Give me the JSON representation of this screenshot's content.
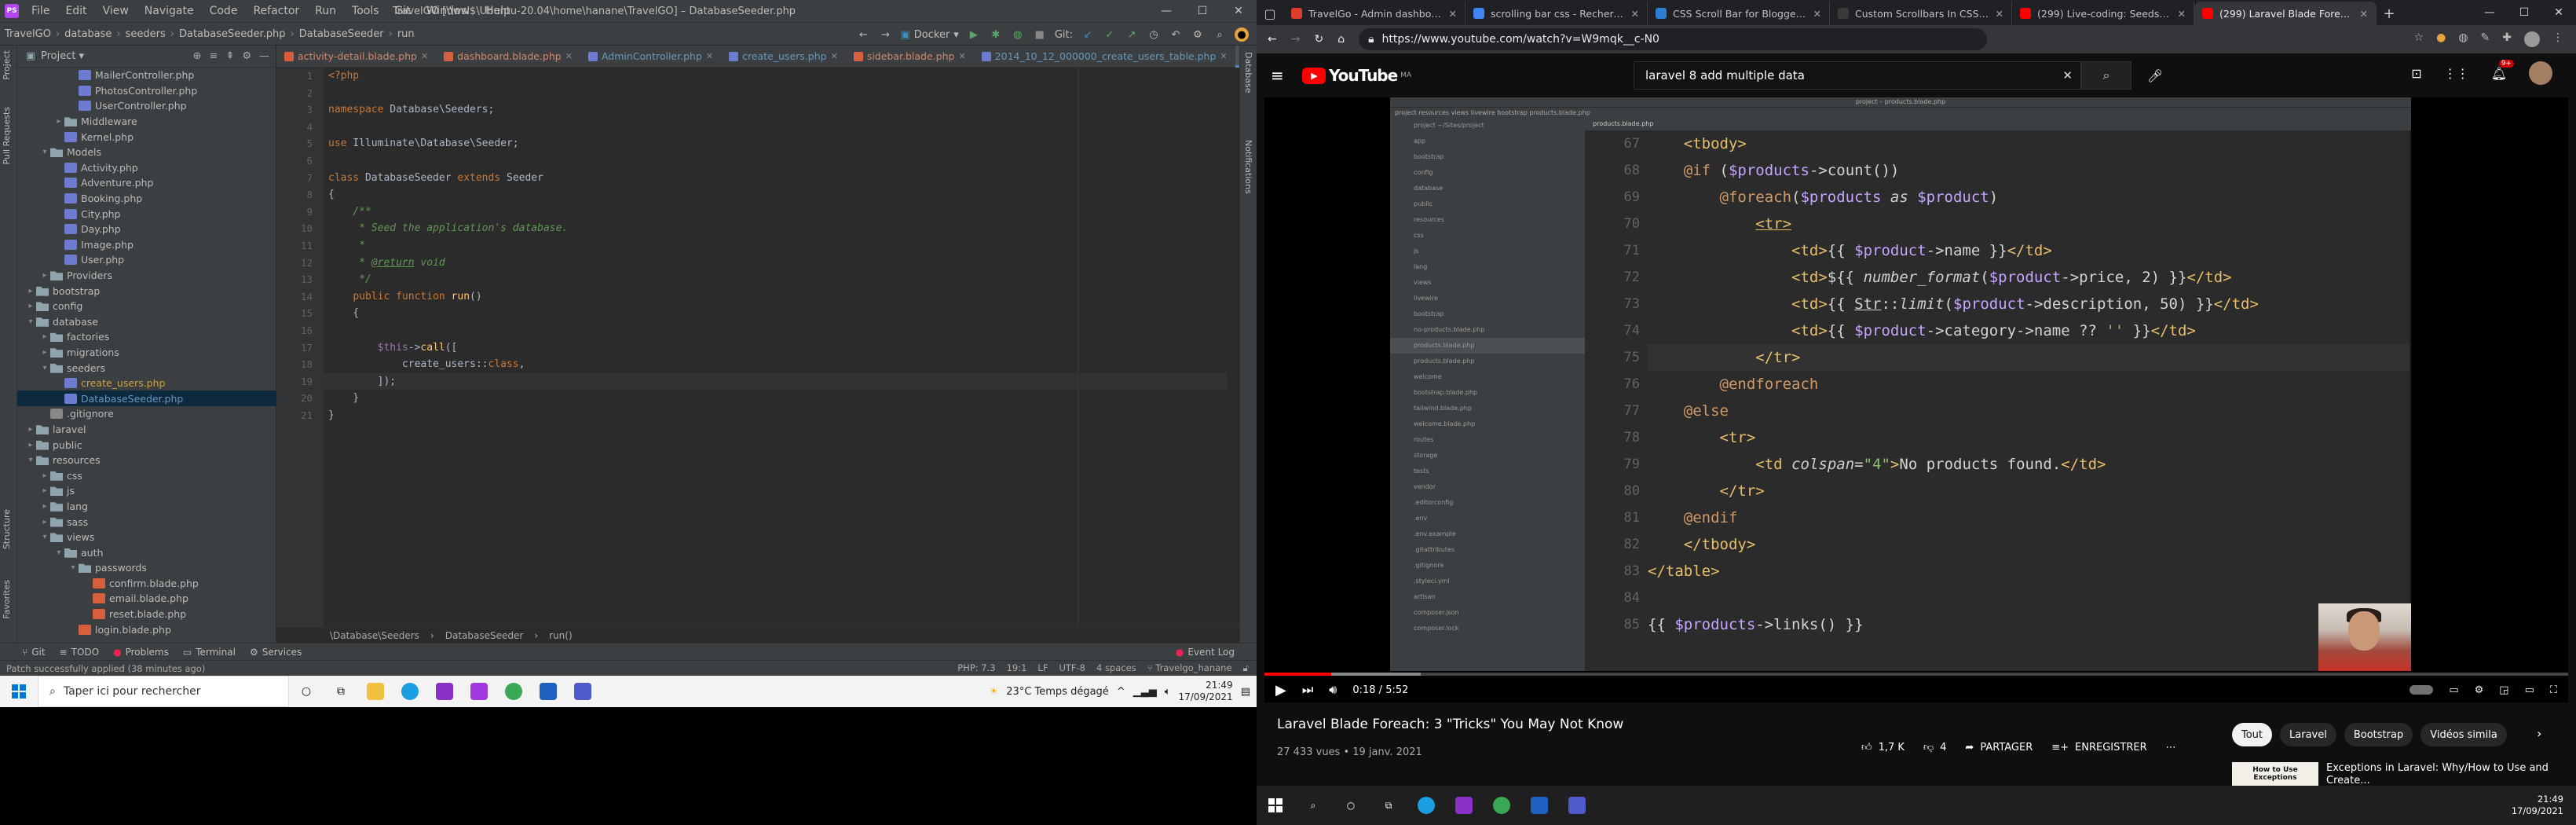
{
  "ide": {
    "menu": [
      "File",
      "Edit",
      "View",
      "Navigate",
      "Code",
      "Refactor",
      "Run",
      "Tools",
      "Git",
      "Window",
      "Help"
    ],
    "window_title": "TravelGO [\\\\wsl$\\Ubuntu-20.04\\home\\hanane\\TravelGO] – DatabaseSeeder.php",
    "breadcrumb": [
      "TravelGO",
      "database",
      "seeders",
      "DatabaseSeeder.php",
      "DatabaseSeeder",
      "run"
    ],
    "run_config": "Docker",
    "git_label": "Git:",
    "project_label": "Project",
    "left_stripe": [
      "Project",
      "Pull Requests",
      "Structure",
      "Favorites"
    ],
    "right_stripe": [
      "Database",
      "Notifications"
    ],
    "tree": [
      {
        "depth": 3,
        "type": "php",
        "label": "MailerController.php"
      },
      {
        "depth": 3,
        "type": "php",
        "label": "PhotosController.php"
      },
      {
        "depth": 3,
        "type": "php",
        "label": "UserController.php"
      },
      {
        "depth": 2,
        "type": "folder",
        "arrow": "▸",
        "label": "Middleware"
      },
      {
        "depth": 2,
        "type": "php",
        "label": "Kernel.php"
      },
      {
        "depth": 1,
        "type": "folder",
        "arrow": "▾",
        "label": "Models"
      },
      {
        "depth": 2,
        "type": "php",
        "label": "Activity.php"
      },
      {
        "depth": 2,
        "type": "php",
        "label": "Adventure.php"
      },
      {
        "depth": 2,
        "type": "php",
        "label": "Booking.php"
      },
      {
        "depth": 2,
        "type": "php",
        "label": "City.php"
      },
      {
        "depth": 2,
        "type": "php",
        "label": "Day.php"
      },
      {
        "depth": 2,
        "type": "php",
        "label": "Image.php"
      },
      {
        "depth": 2,
        "type": "php",
        "label": "User.php"
      },
      {
        "depth": 1,
        "type": "folder",
        "arrow": "▸",
        "label": "Providers"
      },
      {
        "depth": 0,
        "type": "folder",
        "arrow": "▸",
        "label": "bootstrap"
      },
      {
        "depth": 0,
        "type": "folder",
        "arrow": "▸",
        "label": "config"
      },
      {
        "depth": 0,
        "type": "folder",
        "arrow": "▾",
        "label": "database"
      },
      {
        "depth": 1,
        "type": "folder",
        "arrow": "▸",
        "label": "factories"
      },
      {
        "depth": 1,
        "type": "folder",
        "arrow": "▸",
        "label": "migrations"
      },
      {
        "depth": 1,
        "type": "folder",
        "arrow": "▾",
        "label": "seeders"
      },
      {
        "depth": 2,
        "type": "php",
        "label": "create_users.php",
        "style": "yellow"
      },
      {
        "depth": 2,
        "type": "php",
        "label": "DatabaseSeeder.php",
        "style": "blue",
        "selected": true
      },
      {
        "depth": 1,
        "type": "file",
        "label": ".gitignore"
      },
      {
        "depth": 0,
        "type": "folder",
        "arrow": "▸",
        "label": "laravel"
      },
      {
        "depth": 0,
        "type": "folder",
        "arrow": "▸",
        "label": "public"
      },
      {
        "depth": 0,
        "type": "folder",
        "arrow": "▾",
        "label": "resources"
      },
      {
        "depth": 1,
        "type": "folder",
        "arrow": "▸",
        "label": "css"
      },
      {
        "depth": 1,
        "type": "folder",
        "arrow": "▸",
        "label": "js"
      },
      {
        "depth": 1,
        "type": "folder",
        "arrow": "▸",
        "label": "lang"
      },
      {
        "depth": 1,
        "type": "folder",
        "arrow": "▸",
        "label": "sass"
      },
      {
        "depth": 1,
        "type": "folder",
        "arrow": "▾",
        "label": "views"
      },
      {
        "depth": 2,
        "type": "folder",
        "arrow": "▾",
        "label": "auth"
      },
      {
        "depth": 3,
        "type": "folder",
        "arrow": "▾",
        "label": "passwords"
      },
      {
        "depth": 4,
        "type": "blade",
        "label": "confirm.blade.php"
      },
      {
        "depth": 4,
        "type": "blade",
        "label": "email.blade.php"
      },
      {
        "depth": 4,
        "type": "blade",
        "label": "reset.blade.php"
      },
      {
        "depth": 3,
        "type": "blade",
        "label": "login.blade.php"
      }
    ],
    "tabs": [
      {
        "label": "activity-detail.blade.php",
        "type": "blade"
      },
      {
        "label": "dashboard.blade.php",
        "type": "blade"
      },
      {
        "label": "AdminController.php",
        "type": "php"
      },
      {
        "label": "create_users.php",
        "type": "php"
      },
      {
        "label": "sidebar.blade.php",
        "type": "blade"
      },
      {
        "label": "2014_10_12_000000_create_users_table.php",
        "type": "php"
      },
      {
        "label": "DatabaseSeeder.php",
        "type": "php",
        "active": true
      }
    ],
    "line_numbers": [
      "1",
      "2",
      "3",
      "4",
      "5",
      "6",
      "7",
      "8",
      "9",
      "10",
      "11",
      "12",
      "13",
      "14",
      "15",
      "16",
      "17",
      "18",
      "19",
      "20",
      "21"
    ],
    "code_breadcrumb": [
      "\\Database\\Seeders",
      "DatabaseSeeder",
      "run()"
    ],
    "bottom_tools": [
      "Git",
      "TODO",
      "Problems",
      "Terminal",
      "Services"
    ],
    "event_log": "Event Log",
    "status_message": "Patch successfully applied (38 minutes ago)",
    "status_right": [
      "PHP: 7.3",
      "19:1",
      "LF",
      "UTF-8",
      "4 spaces",
      "Travelgo_hanane"
    ]
  },
  "taskbar_left": {
    "search_placeholder": "Taper ici pour rechercher",
    "weather": "23°C  Temps dégagé",
    "time": "21:49",
    "date": "17/09/2021"
  },
  "browser": {
    "tabs": [
      {
        "label": "TravelGo - Admin dashboard",
        "color": "#e03c2e"
      },
      {
        "label": "scrolling bar css - Recherche Go",
        "color": "#4285f4"
      },
      {
        "label": "CSS Scroll Bar for Blogger - An I",
        "color": "#2d7dd2"
      },
      {
        "label": "Custom Scrollbars In CSS - Ahm",
        "color": "#3a3a3a"
      },
      {
        "label": "(299) Live-coding: Seeds and Fa",
        "color": "#ff0000"
      },
      {
        "label": "(299) Laravel Blade Foreach",
        "color": "#ff0000",
        "active": true
      }
    ],
    "url": "https://www.youtube.com/watch?v=W9mqk__c-N0",
    "yt": {
      "logo_text": "YouTube",
      "country": "MA",
      "search_value": "laravel 8 add multiple data",
      "notif_count": "9+",
      "video": {
        "ide_title": "project – products.blade.php",
        "ide_tab": "products.blade.php",
        "ide_breadcrumb": "project  resources  views  livewire  bootstrap  products.blade.php",
        "line_numbers": [
          "67",
          "68",
          "69",
          "70",
          "71",
          "72",
          "73",
          "74",
          "75",
          "76",
          "77",
          "78",
          "79",
          "80",
          "81",
          "82",
          "83",
          "84",
          "85"
        ],
        "tree": [
          "project ~/Sites/project",
          "app",
          "bootstrap",
          "config",
          "database",
          "public",
          "resources",
          "css",
          "js",
          "lang",
          "views",
          "livewire",
          "bootstrap",
          "no-products.blade.php",
          "products.blade.php",
          "products.blade.php",
          "welcome",
          "bootstrap.blade.php",
          "tailwind.blade.php",
          "welcome.blade.php",
          "routes",
          "storage",
          "tests",
          "vendor",
          ".editorconfig",
          ".env",
          ".env.example",
          ".gitattributes",
          ".gitignore",
          ".styleci.yml",
          "artisan",
          "composer.json",
          "composer.lock"
        ]
      },
      "time_current": "0:18",
      "time_total": "5:52",
      "progress": 0.051,
      "loaded": 0.12,
      "title": "Laravel Blade Foreach: 3 \"Tricks\" You May Not Know",
      "views": "27 433 vues • 19 janv. 2021",
      "likes": "1,7 K",
      "dislikes": "4",
      "share": "PARTAGER",
      "save": "ENREGISTRER",
      "chips": [
        "Tout",
        "Laravel",
        "Bootstrap",
        "Vidéos simila"
      ],
      "rec_title": "Exceptions in Laravel: Why/How to Use and Create...",
      "rec_thumb": "How to Use Exceptions"
    }
  },
  "taskbar_right": {
    "time": "21:49",
    "date": "17/09/2021"
  }
}
